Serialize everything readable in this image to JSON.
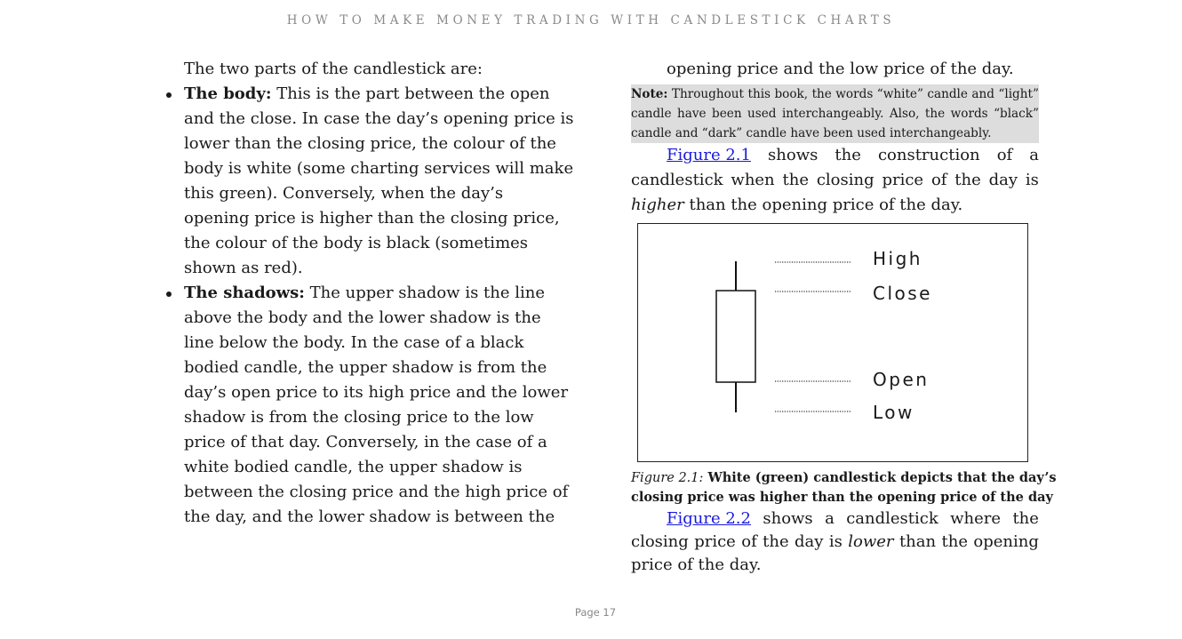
{
  "running_head": "HOW TO MAKE MONEY TRADING WITH CANDLESTICK CHARTS",
  "left": {
    "intro": "The two parts of the candlestick are:",
    "body_term": "The body:",
    "body_lines": [
      " This is the part between the open",
      "and the close. In case the day’s opening price is",
      "lower than the closing price, the colour of the",
      "body is white (some charting services will make",
      "this green). Conversely, when the day’s",
      "opening price is higher than the closing price,",
      "the colour of the body is black (sometimes",
      "shown as red)."
    ],
    "shadows_term": "The shadows:",
    "shadows_lines": [
      " The upper shadow is the line",
      "above the body and the lower shadow is the",
      "line below the body. In the case of a black",
      "bodied candle, the upper shadow is from the",
      "day’s open price to its high price and the lower",
      "shadow is from the closing price to the low",
      "price of that day. Conversely, in the case of a",
      "white bodied candle, the upper shadow is",
      "between the closing price and the high price of",
      "the day, and the lower shadow is between the"
    ]
  },
  "right": {
    "continuation": "opening price and the low price of the day.",
    "note": {
      "label": "Note:",
      "line1_words": [
        "Throughout",
        "this",
        "book,",
        "the",
        "words",
        "“white”",
        "candle",
        "and",
        "“light”"
      ],
      "line2_words": [
        "candle",
        "have",
        "been",
        "used",
        "interchangeably.",
        "Also,",
        "the",
        "words",
        "“black”"
      ],
      "line3": "candle and “dark” candle have been used interchangeably."
    },
    "para1": {
      "link": "Figure 2.1",
      "line1_words": [
        "shows",
        "the",
        "construction",
        "of",
        "a"
      ],
      "line2_words": [
        "candlestick",
        "when",
        "the",
        "closing",
        "price",
        "of",
        "the",
        "day",
        "is"
      ],
      "line3_italic": "higher",
      "line3_rest": " than the opening price of the day."
    },
    "figure": {
      "labels": {
        "high": "High",
        "close": "Close",
        "open": "Open",
        "low": "Low"
      },
      "caption_prefix": "Figure 2.1:",
      "caption_line1": " White (green) candlestick depicts that the day’s",
      "caption_line2": "closing price was higher than the opening price of the day"
    },
    "para2": {
      "link": "Figure 2.2",
      "line1_words": [
        "shows",
        "a",
        "candlestick",
        "where",
        "the"
      ],
      "line2_pre": [
        "closing",
        "price",
        "of",
        "the",
        "day",
        "is"
      ],
      "line2_italic": "lower",
      "line2_post": [
        "than",
        "the",
        "opening"
      ],
      "line3": "price of the day."
    }
  },
  "page_number": "Page 17"
}
